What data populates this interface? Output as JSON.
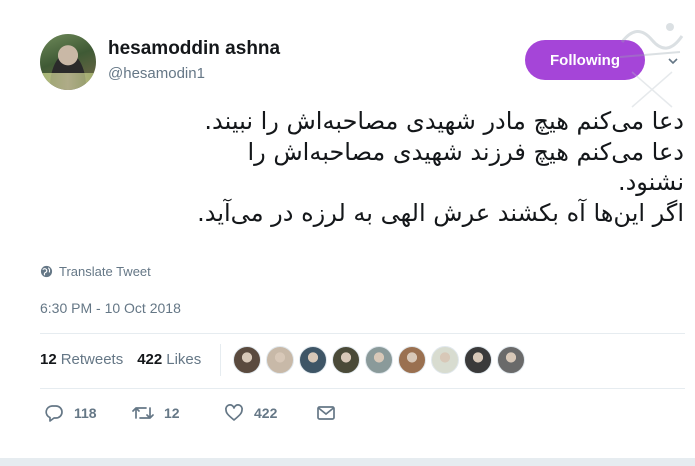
{
  "user": {
    "display_name": "hesamoddin ashna",
    "handle": "@hesamodin1",
    "follow_label": "Following",
    "follow_color": "#a545d8"
  },
  "tweet": {
    "lines": [
      "دعا می‌کنم هیچ مادر شهیدی مصاحبه‌اش را نبیند.",
      "دعا می‌کنم هیچ فرزند شهیدی مصاحبه‌اش را",
      "نشنود.",
      "اگر این‌ها آه بکشند عرش الهی به لرزه در می‌آید."
    ],
    "translate_label": "Translate Tweet",
    "timestamp": "6:30 PM - 10 Oct 2018"
  },
  "stats": {
    "retweets_count": "12",
    "retweets_label": "Retweets",
    "likes_count": "422",
    "likes_label": "Likes"
  },
  "likers": [
    {
      "color": "#5a4a3e"
    },
    {
      "color": "#c8b9a8"
    },
    {
      "color": "#3e5566"
    },
    {
      "color": "#4a4a38"
    },
    {
      "color": "#8a9a9a"
    },
    {
      "color": "#9a7050"
    },
    {
      "color": "#d8dcd0"
    },
    {
      "color": "#3a3a3a"
    },
    {
      "color": "#6a6a6a"
    }
  ],
  "actions": {
    "reply_count": "118",
    "retweet_count": "12",
    "like_count": "422"
  },
  "icons": [
    "reply-icon",
    "retweet-icon",
    "like-icon",
    "direct-message-icon",
    "globe-icon",
    "caret-down-icon"
  ]
}
